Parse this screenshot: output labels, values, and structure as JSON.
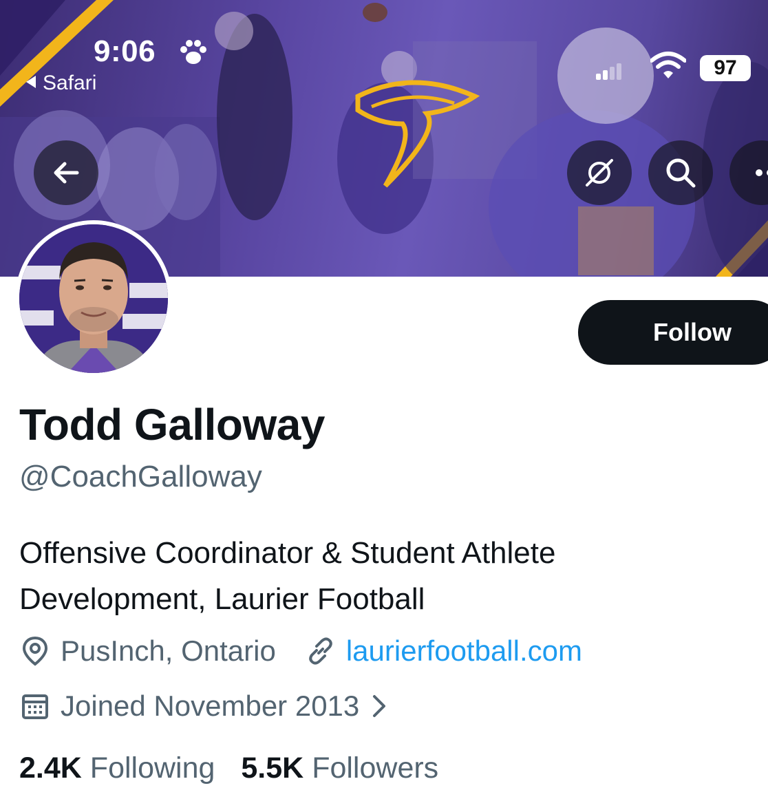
{
  "status_bar": {
    "time": "9:06",
    "back_app": "Safari",
    "battery": "97"
  },
  "header_actions": {
    "back_icon": "arrow-left-icon",
    "grok_icon": "slash-circle-icon",
    "search_icon": "search-icon",
    "more_icon": "more-dots-icon"
  },
  "profile": {
    "follow_label": "Follow",
    "name": "Todd Galloway",
    "handle": "@CoachGalloway",
    "bio": "Offensive Coordinator & Student Athlete Development, Laurier Football",
    "location": "PusInch, Ontario",
    "website": "laurierfootball.com",
    "joined": "Joined November 2013"
  },
  "stats": {
    "following_count": "2.4K",
    "following_label": "Following",
    "followers_count": "5.5K",
    "followers_label": "Followers"
  },
  "colors": {
    "banner_purple": "#5a47a3",
    "gold": "#f2b51b",
    "link_blue": "#1d9bf0",
    "secondary_text": "#536471"
  }
}
